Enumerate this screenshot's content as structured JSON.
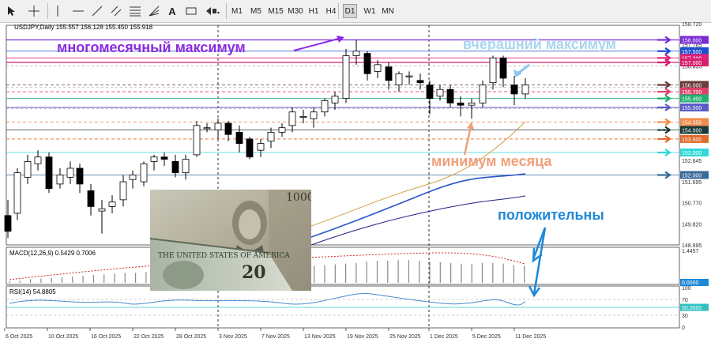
{
  "toolbar": {
    "timeframes": [
      "M1",
      "M5",
      "M15",
      "M30",
      "H1",
      "H4",
      "D1",
      "W1",
      "MN"
    ],
    "active_timeframe": "D1",
    "tool_icons": [
      "cursor-icon",
      "crosshair-icon",
      "vertical-line-icon",
      "horizontal-line-icon",
      "trend-line-icon",
      "channel-icon",
      "fibonacci-icon",
      "text-icon",
      "label-icon",
      "arrows-icon"
    ]
  },
  "chart": {
    "header": "USDJPY,Daily  155.557 156.128 155.450 155.918",
    "price_ticks": [
      "158.720",
      "157.785",
      "156.835",
      "155.900",
      "154.950",
      "154.015",
      "153.080",
      "152.645",
      "151.695",
      "150.770",
      "149.820",
      "148.895"
    ],
    "date_ticks": [
      "6 Oct 2025",
      "10 Oct 2025",
      "16 Oct 2025",
      "22 Oct 2025",
      "28 Oct 2025",
      "3 Nov 2025",
      "7 Nov 2025",
      "13 Nov 2025",
      "19 Nov 2025",
      "25 Nov 2025",
      "1 Dec 2025",
      "5 Dec 2025",
      "11 Dec 2025"
    ],
    "levels": [
      {
        "value": "158.000",
        "color": "#7a2bd6"
      },
      {
        "value": "157.500",
        "color": "#1e4fd0"
      },
      {
        "value": "157.200",
        "color": "#e0207a"
      },
      {
        "value": "157.000",
        "color": "#d6206e"
      },
      {
        "value": "156.000",
        "color": "#6b3a3a"
      },
      {
        "value": "155.700",
        "color": "#e0406a"
      },
      {
        "value": "155.400",
        "color": "#20b070"
      },
      {
        "value": "155.000",
        "color": "#5a5ac8"
      },
      {
        "value": "154.350",
        "color": "#f08a4a"
      },
      {
        "value": "154.000",
        "color": "#1a3a3a"
      },
      {
        "value": "153.600",
        "color": "#e06a2a"
      },
      {
        "value": "153.000",
        "color": "#30d8d8"
      },
      {
        "value": "152.000",
        "color": "#3a6a9a"
      }
    ],
    "annotations": {
      "multi_month_high": "многомесячный максимум",
      "yesterday_high": "вчерашний максимум",
      "month_low": "минимум месяца",
      "positive": "положительны"
    },
    "macd": {
      "header": "MACD(12,26,9) 0.5429 0.7006",
      "top_value": "1.4457",
      "zero_value": "0.0000"
    },
    "rsi": {
      "header": "RSI(14) 54.8805",
      "ticks": [
        "100",
        "70",
        "50",
        "30",
        "0"
      ],
      "level_value": "50.0000"
    }
  }
}
